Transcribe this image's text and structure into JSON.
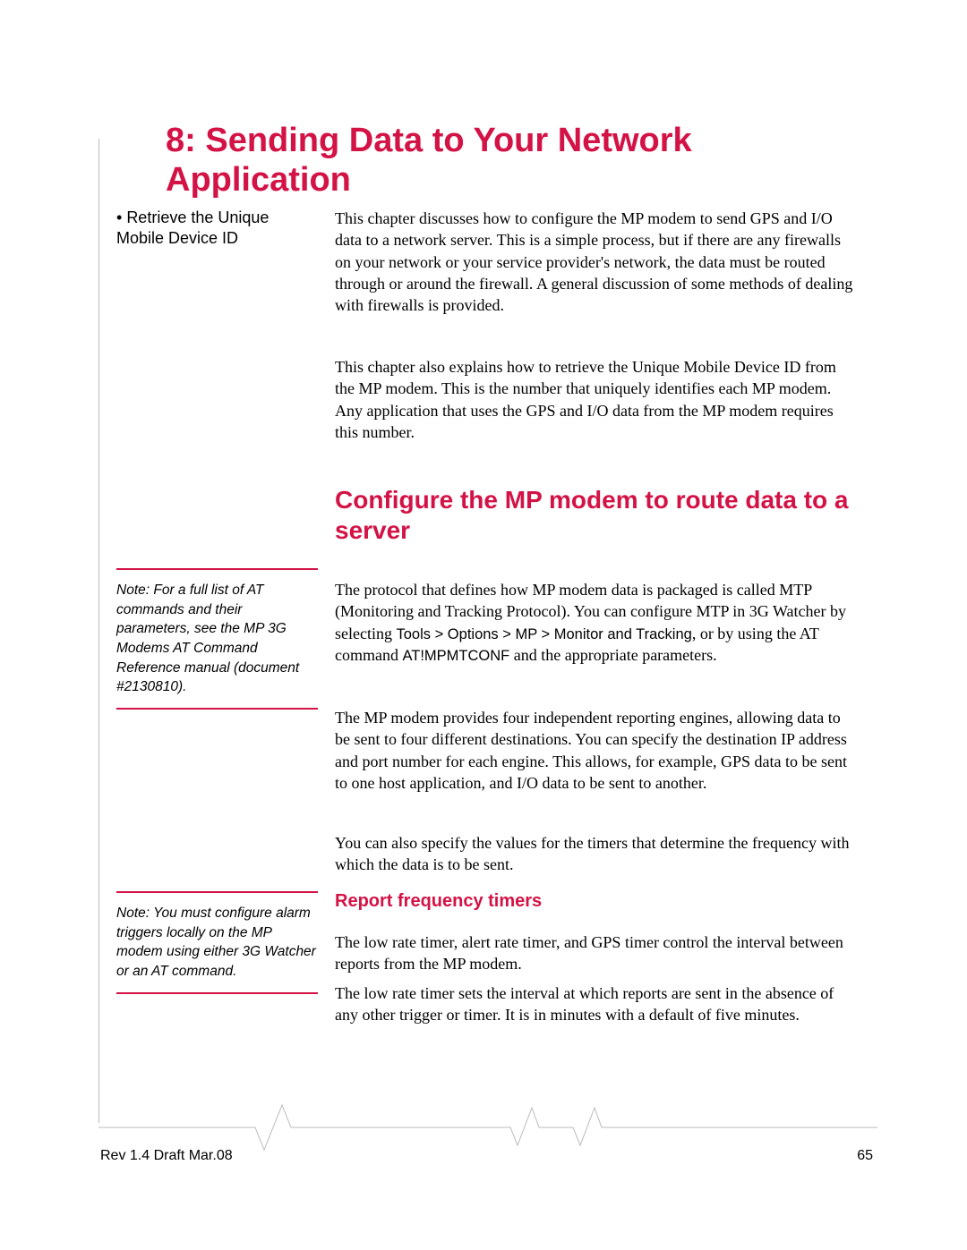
{
  "chapter": {
    "number": "8",
    "title": "8: Sending Data to Your Network Application"
  },
  "sidebar": {
    "bullet_item": "Retrieve the Unique Mobile Device ID",
    "note1": "Note: For a full list of AT commands and their parameters, see the MP 3G Modems AT Command Reference manual (document #2130810).",
    "note2": "Note: You must configure alarm triggers locally on the MP modem using either 3G Watcher or an AT command."
  },
  "intro": {
    "para1": "This chapter discusses how to configure the MP modem to send GPS and I/O data to a network server. This is a simple process, but if there are any firewalls on your network or your service provider's network, the data must be routed through or around the firewall. A general discussion of some methods of dealing with firewalls is provided.",
    "para2": "This chapter also explains how to retrieve the Unique Mobile Device ID from the MP modem. This is the number that uniquely identifies each MP modem. Any application that uses the GPS and I/O data from the MP modem requires this number."
  },
  "section": {
    "heading": "Configure the MP modem to route data to a server",
    "para1_start": "The protocol that defines how MP modem data is packaged is called MTP (Monitoring and Tracking Protocol). You can configure MTP in 3G Watcher by selecting ",
    "para1_menu": "Tools > Options > MP > Monitor and Tracking",
    "para1_mid": ", or by using the AT command ",
    "para1_cmd": "AT!MPMTCONF",
    "para1_end": " and the appropriate parameters.",
    "para2": "The MP modem provides four independent reporting engines, allowing data to be sent to four different destinations. You can specify the destination IP address and port number for each engine. This allows, for example, GPS data to be sent to one host application, and I/O data to be sent to another.",
    "para3": "You can also specify the values for the timers that determine the frequency with which the data is to be sent."
  },
  "subsection": {
    "heading": "Report frequency timers",
    "para1": "The low rate timer, alert rate timer, and GPS timer control the interval between reports from the MP modem.",
    "para2": "The low rate timer sets the interval at which reports are sent in the absence of any other trigger or timer. It is in minutes with a default of five minutes."
  },
  "footer": {
    "left": "Rev 1.4 Draft  Mar.08",
    "page_number": "65"
  }
}
